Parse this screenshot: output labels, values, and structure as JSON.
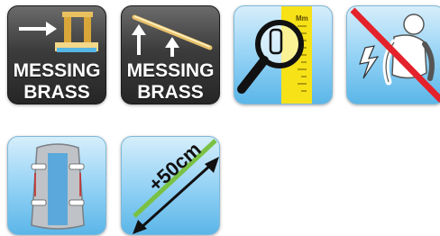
{
  "icons": [
    {
      "name": "brass-threshold-icon",
      "line1": "MESSING",
      "line2": "BRASS"
    },
    {
      "name": "brass-rod-lift-icon",
      "line1": "MESSING",
      "line2": "BRASS"
    },
    {
      "name": "measuring-magnifier-icon",
      "scale_label": "Mm"
    },
    {
      "name": "no-back-pain-icon"
    },
    {
      "name": "back-support-icon"
    },
    {
      "name": "extension-length-icon",
      "length_label": "+50cm"
    }
  ],
  "colors": {
    "dark_tile": "#3c3c3c",
    "blue_tile": "#8fd0f4",
    "brass": "#e3b64a",
    "yellow": "#f7e218",
    "red": "#e4222b",
    "green": "#7ac143"
  }
}
